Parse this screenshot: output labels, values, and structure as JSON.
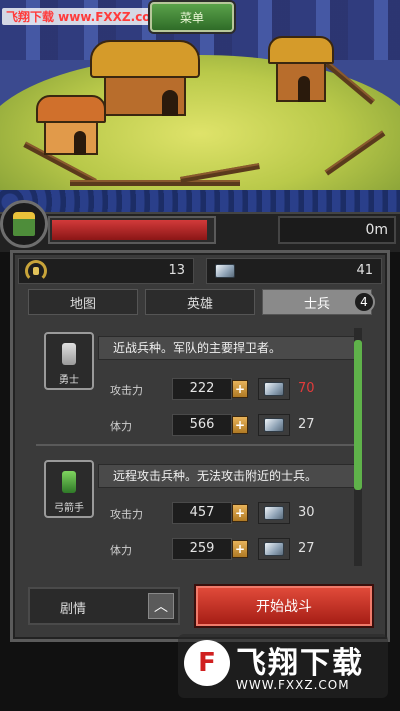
{
  "watermark_top": "飞翔下载 www.FXXZ.com",
  "header": {
    "menu_label": "菜单"
  },
  "hero": {
    "hp_fraction": 0.97,
    "distance": "0m"
  },
  "resources": {
    "medals": "13",
    "gems": "41"
  },
  "tabs": [
    {
      "label": "地图",
      "active": false
    },
    {
      "label": "英雄",
      "active": false
    },
    {
      "label": "士兵",
      "active": true,
      "badge": "4"
    }
  ],
  "units": [
    {
      "name": "勇士",
      "desc": "近战兵种。军队的主要捍卫者。",
      "sprite_color": "#cfcfcf",
      "stats": [
        {
          "label": "攻击力",
          "value": "222",
          "cost": "70",
          "cost_red": true
        },
        {
          "label": "体力",
          "value": "566",
          "cost": "27",
          "cost_red": false
        }
      ]
    },
    {
      "name": "弓箭手",
      "desc": "远程攻击兵种。无法攻击附近的士兵。",
      "sprite_color": "#5fbf4a",
      "stats": [
        {
          "label": "攻击力",
          "value": "457",
          "cost": "30",
          "cost_red": false
        },
        {
          "label": "体力",
          "value": "259",
          "cost": "27",
          "cost_red": false
        }
      ]
    }
  ],
  "plus": "+",
  "footer": {
    "story_label": "剧情",
    "story_arrow": "︿",
    "start_label": "开始战斗"
  },
  "watermark": {
    "logo": "F",
    "title": "飞翔下载",
    "url": "WWW.FXXZ.COM"
  },
  "colors": {
    "start_button": "#c42a20",
    "menu_button": "#3f8436",
    "hp": "#c22a2a",
    "scroll": "#5fb24a"
  }
}
